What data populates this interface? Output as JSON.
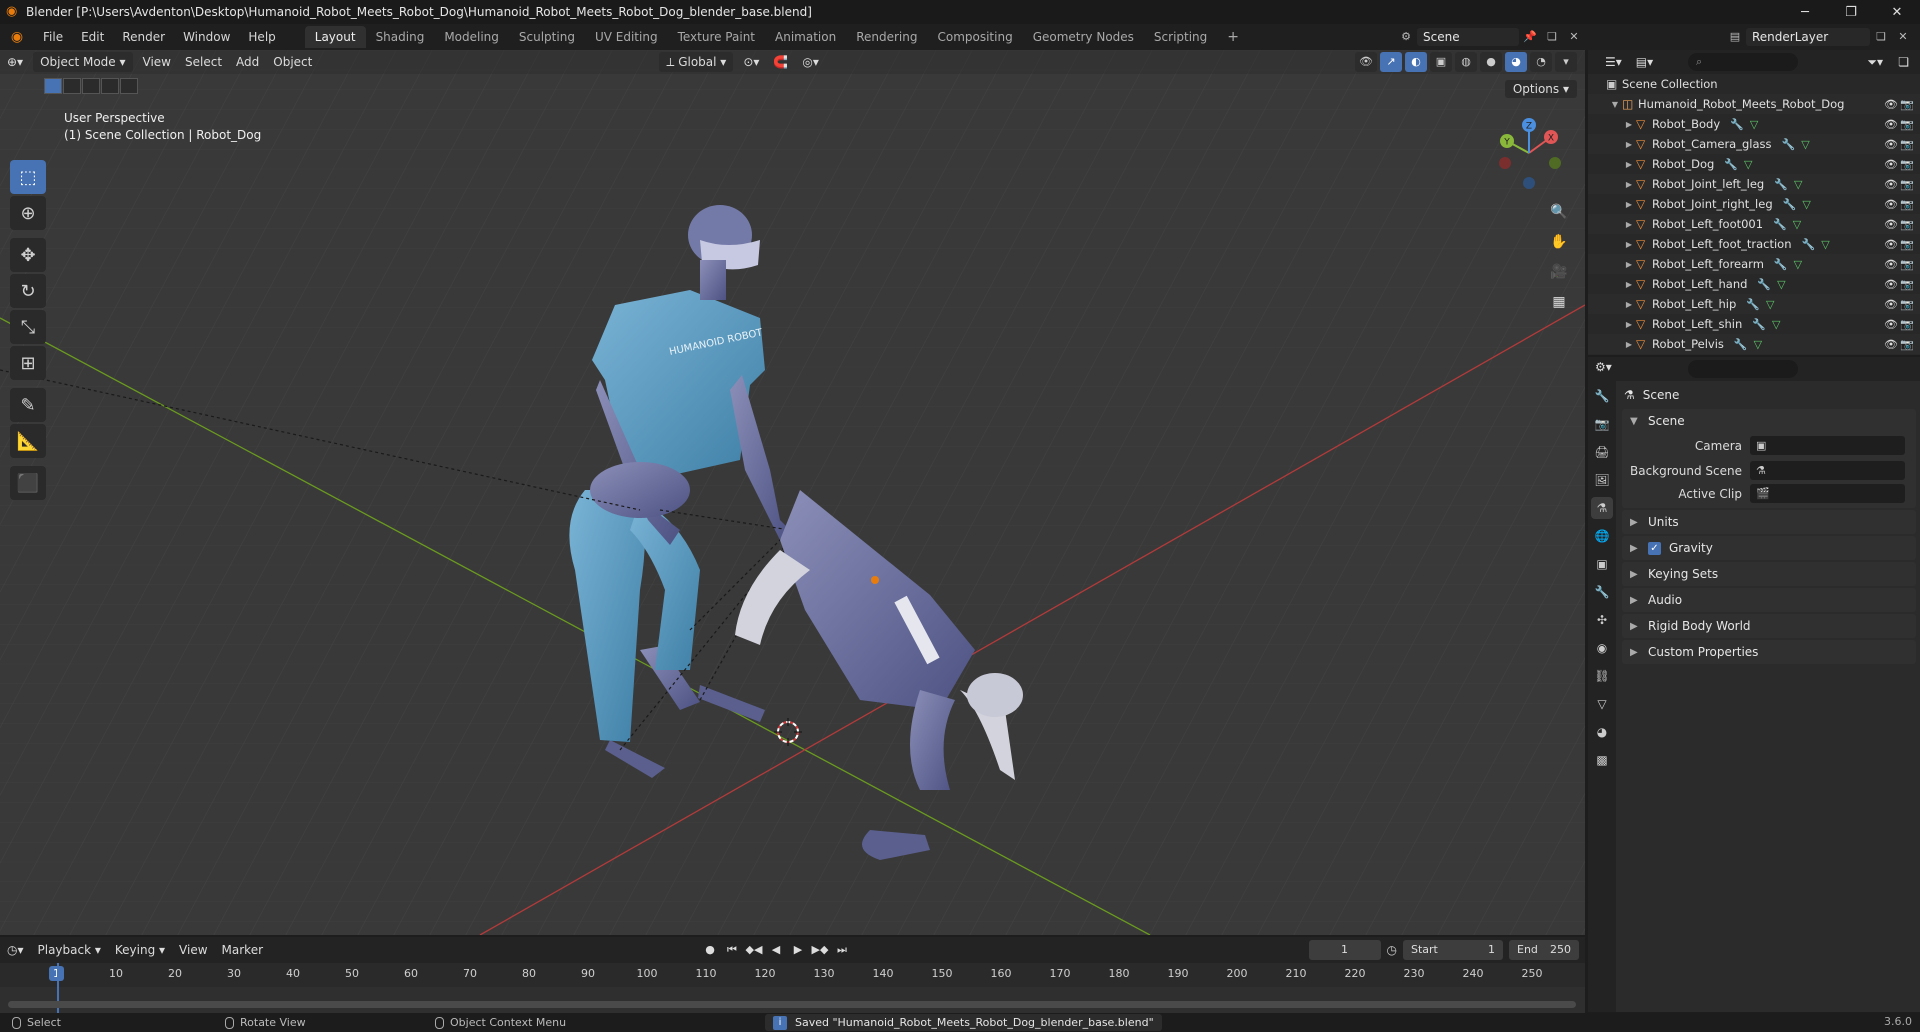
{
  "window": {
    "title": "Blender [P:\\Users\\Avdenton\\Desktop\\Humanoid_Robot_Meets_Robot_Dog\\Humanoid_Robot_Meets_Robot_Dog_blender_base.blend]"
  },
  "menu": [
    "File",
    "Edit",
    "Render",
    "Window",
    "Help"
  ],
  "workspaces": [
    "Layout",
    "Shading",
    "Modeling",
    "Sculpting",
    "UV Editing",
    "Texture Paint",
    "Animation",
    "Rendering",
    "Compositing",
    "Geometry Nodes",
    "Scripting"
  ],
  "workspace_add": "+",
  "scene_name": "Scene",
  "render_layer": "RenderLayer",
  "viewport": {
    "mode": "Object Mode",
    "menus": [
      "View",
      "Select",
      "Add",
      "Object"
    ],
    "orientation": "Global",
    "options": "Options",
    "info_line1": "User Perspective",
    "info_line2": "(1) Scene Collection | Robot_Dog",
    "gizmo_x": "X",
    "gizmo_y": "Y",
    "gizmo_z": "Z",
    "shirt_text": "HUMANOID ROBOT"
  },
  "timeline": {
    "menus": [
      "Playback",
      "Keying",
      "View",
      "Marker"
    ],
    "current_frame": "1",
    "start_label": "Start",
    "start": "1",
    "end_label": "End",
    "end": "250",
    "ruler": [
      "10",
      "20",
      "30",
      "40",
      "50",
      "60",
      "70",
      "80",
      "90",
      "100",
      "110",
      "120",
      "130",
      "140",
      "150",
      "160",
      "170",
      "180",
      "190",
      "200",
      "210",
      "220",
      "230",
      "240",
      "250"
    ]
  },
  "statusbar": {
    "select": "Select",
    "rotate": "Rotate View",
    "context": "Object Context Menu",
    "saved": "Saved \"Humanoid_Robot_Meets_Robot_Dog_blender_base.blend\"",
    "version": "3.6.0"
  },
  "outliner": {
    "root": "Scene Collection",
    "collection": "Humanoid_Robot_Meets_Robot_Dog",
    "objects": [
      "Robot_Body",
      "Robot_Camera_glass",
      "Robot_Dog",
      "Robot_Joint_left_leg",
      "Robot_Joint_right_leg",
      "Robot_Left_foot001",
      "Robot_Left_foot_traction",
      "Robot_Left_forearm",
      "Robot_Left_hand",
      "Robot_Left_hip",
      "Robot_Left_shin",
      "Robot_Pelvis"
    ]
  },
  "properties": {
    "context_title": "Scene",
    "panel_scene": "Scene",
    "camera_label": "Camera",
    "bg_scene_label": "Background Scene",
    "active_clip_label": "Active Clip",
    "panels": [
      "Units",
      "Gravity",
      "Keying Sets",
      "Audio",
      "Rigid Body World",
      "Custom Properties"
    ]
  },
  "colors": {
    "accent": "#4772b3",
    "blender_orange": "#e87d0d",
    "grid_bg": "#393939",
    "axis_x": "#b33a3a",
    "axis_y": "#6a9a1f"
  }
}
